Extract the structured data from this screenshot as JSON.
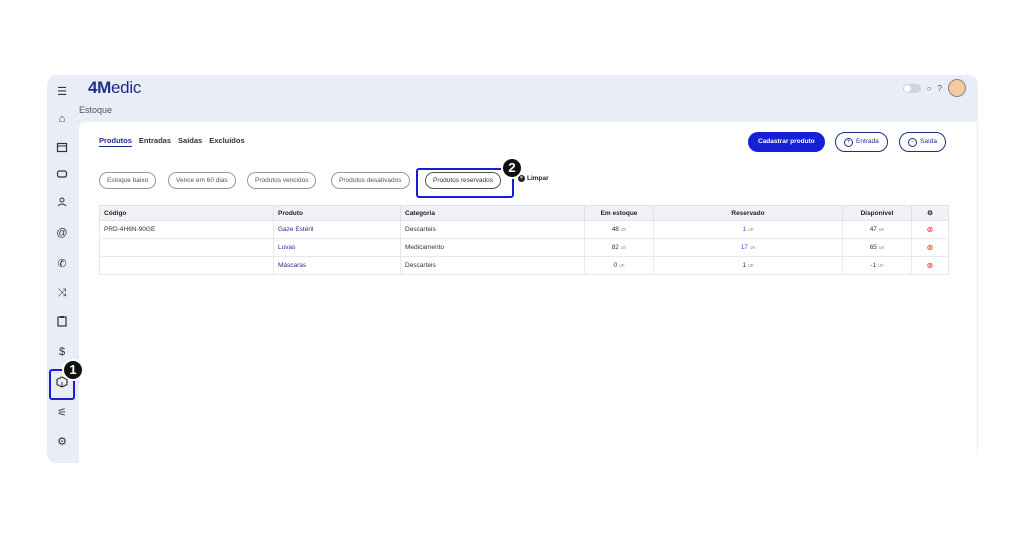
{
  "app": {
    "logo_bold": "4M",
    "logo_rest": "edic"
  },
  "breadcrumb": "Estoque",
  "tabs": [
    "Produtos",
    "Entradas",
    "Saídas",
    "Excluídos"
  ],
  "actions": {
    "add_product": "Cadastrar produto",
    "entry": "Entrada",
    "exit": "Saída"
  },
  "filters": [
    "Estoque baixo",
    "Vence em 60 dias",
    "Produtos vencidos",
    "Produtos desativados",
    "Produtos reservados"
  ],
  "clear_label": "Limpar",
  "table": {
    "headers": [
      "Código",
      "Produto",
      "Categoria",
      "Em estoque",
      "Reservado",
      "Disponível"
    ],
    "unit": "un",
    "rows": [
      {
        "code": "PRD-4H6N-90GE",
        "product": "Gaze Estéril",
        "category": "Descarteis",
        "stock": "48",
        "reserved": "1",
        "available": "47"
      },
      {
        "code": "",
        "product": "Luvas",
        "category": "Medicamento",
        "stock": "82",
        "reserved": "17",
        "available": "65"
      },
      {
        "code": "",
        "product": "Máscaras",
        "category": "Descarteis",
        "stock": "0",
        "reserved": "1",
        "available": "-1"
      }
    ]
  },
  "annotations": {
    "badge1": "1",
    "badge2": "2"
  }
}
